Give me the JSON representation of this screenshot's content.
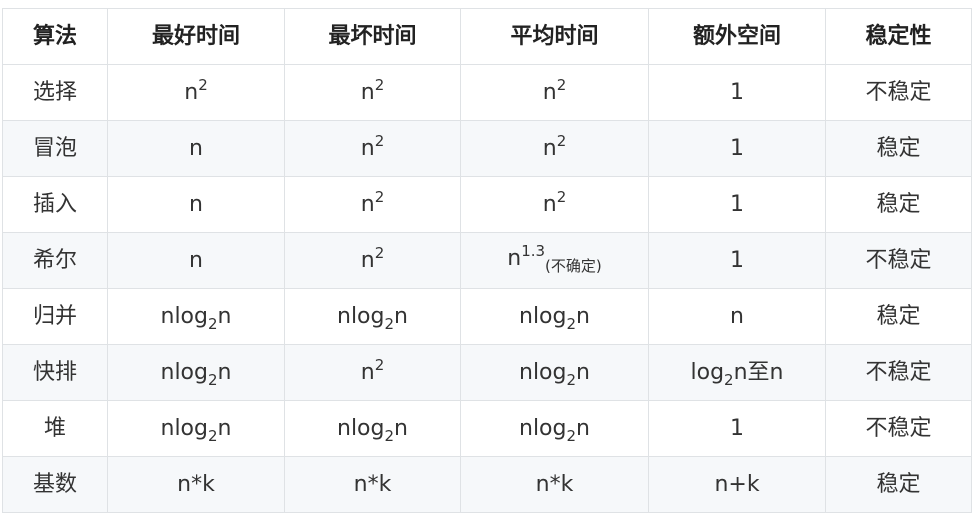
{
  "headers": [
    "算法",
    "最好时间",
    "最坏时间",
    "平均时间",
    "额外空间",
    "稳定性"
  ],
  "rows": [
    {
      "name": "选择",
      "cells": [
        [
          {
            "t": "n"
          },
          {
            "t": "2",
            "sup": true
          }
        ],
        [
          {
            "t": "n"
          },
          {
            "t": "2",
            "sup": true
          }
        ],
        [
          {
            "t": "n"
          },
          {
            "t": "2",
            "sup": true
          }
        ],
        [
          {
            "t": "1"
          }
        ],
        [
          {
            "t": "不稳定"
          }
        ]
      ]
    },
    {
      "name": "冒泡",
      "cells": [
        [
          {
            "t": "n"
          }
        ],
        [
          {
            "t": "n"
          },
          {
            "t": "2",
            "sup": true
          }
        ],
        [
          {
            "t": "n"
          },
          {
            "t": "2",
            "sup": true
          }
        ],
        [
          {
            "t": "1"
          }
        ],
        [
          {
            "t": "稳定"
          }
        ]
      ]
    },
    {
      "name": "插入",
      "cells": [
        [
          {
            "t": "n"
          }
        ],
        [
          {
            "t": "n"
          },
          {
            "t": "2",
            "sup": true
          }
        ],
        [
          {
            "t": "n"
          },
          {
            "t": "2",
            "sup": true
          }
        ],
        [
          {
            "t": "1"
          }
        ],
        [
          {
            "t": "稳定"
          }
        ]
      ]
    },
    {
      "name": "希尔",
      "cells": [
        [
          {
            "t": "n"
          }
        ],
        [
          {
            "t": "n"
          },
          {
            "t": "2",
            "sup": true
          }
        ],
        [
          {
            "t": "n"
          },
          {
            "t": "1.3",
            "sup": true
          },
          {
            "t": "(不确定)",
            "note": true
          }
        ],
        [
          {
            "t": "1"
          }
        ],
        [
          {
            "t": "不稳定"
          }
        ]
      ]
    },
    {
      "name": "归并",
      "cells": [
        [
          {
            "t": "nlog"
          },
          {
            "t": "2",
            "sub": true
          },
          {
            "t": "n"
          }
        ],
        [
          {
            "t": "nlog"
          },
          {
            "t": "2",
            "sub": true
          },
          {
            "t": "n"
          }
        ],
        [
          {
            "t": "nlog"
          },
          {
            "t": "2",
            "sub": true
          },
          {
            "t": "n"
          }
        ],
        [
          {
            "t": "n"
          }
        ],
        [
          {
            "t": "稳定"
          }
        ]
      ]
    },
    {
      "name": "快排",
      "cells": [
        [
          {
            "t": "nlog"
          },
          {
            "t": "2",
            "sub": true
          },
          {
            "t": "n"
          }
        ],
        [
          {
            "t": "n"
          },
          {
            "t": "2",
            "sup": true
          }
        ],
        [
          {
            "t": "nlog"
          },
          {
            "t": "2",
            "sub": true
          },
          {
            "t": "n"
          }
        ],
        [
          {
            "t": "log"
          },
          {
            "t": "2",
            "sub": true
          },
          {
            "t": "n至n"
          }
        ],
        [
          {
            "t": "不稳定"
          }
        ]
      ]
    },
    {
      "name": "堆",
      "cells": [
        [
          {
            "t": "nlog"
          },
          {
            "t": "2",
            "sub": true
          },
          {
            "t": "n"
          }
        ],
        [
          {
            "t": "nlog"
          },
          {
            "t": "2",
            "sub": true
          },
          {
            "t": "n"
          }
        ],
        [
          {
            "t": "nlog"
          },
          {
            "t": "2",
            "sub": true
          },
          {
            "t": "n"
          }
        ],
        [
          {
            "t": "1"
          }
        ],
        [
          {
            "t": "不稳定"
          }
        ]
      ]
    },
    {
      "name": "基数",
      "cells": [
        [
          {
            "t": "n*k"
          }
        ],
        [
          {
            "t": "n*k"
          }
        ],
        [
          {
            "t": "n*k"
          }
        ],
        [
          {
            "t": "n+k"
          }
        ],
        [
          {
            "t": "稳定"
          }
        ]
      ]
    }
  ]
}
